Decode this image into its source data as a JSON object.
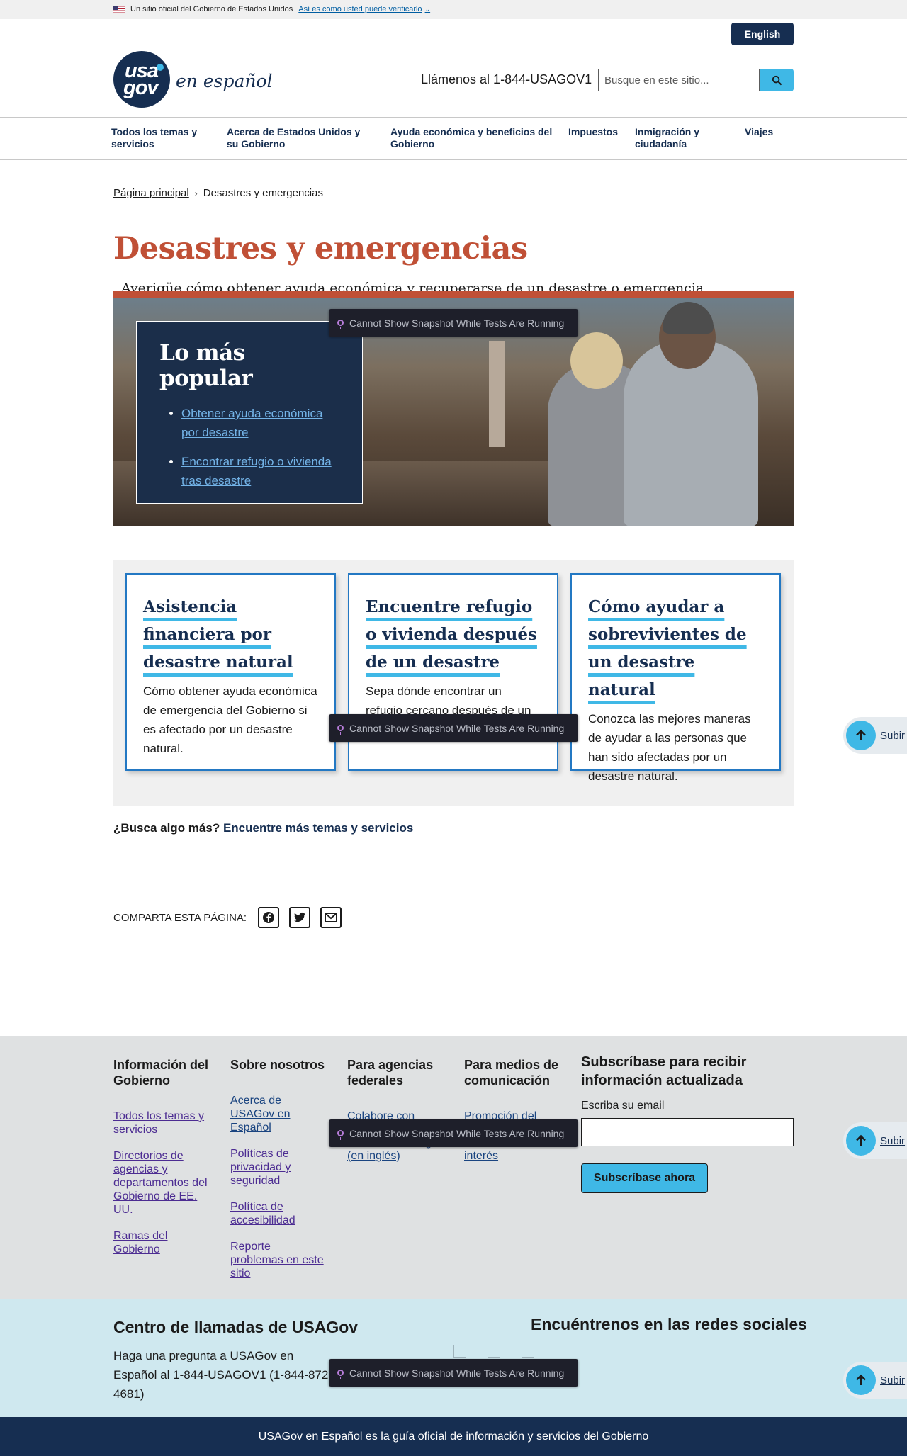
{
  "banner": {
    "official_text": "Un sitio oficial del Gobierno de Estados Unidos",
    "verify_link": "Así es como usted puede verificarlo"
  },
  "header": {
    "language_button": "English",
    "logo_usa": "usa",
    "logo_gov": "gov",
    "logo_text": "en español",
    "phone": "Llámenos al 1-844-USAGOV1",
    "search_placeholder": "Busque en este sitio..."
  },
  "nav": {
    "items": [
      {
        "label": "Todos los temas y servicios"
      },
      {
        "label": "Acerca de Estados Unidos y su Gobierno"
      },
      {
        "label": "Ayuda económica y beneficios del Gobierno"
      },
      {
        "label": "Impuestos"
      },
      {
        "label": "Inmigración y ciudadanía"
      },
      {
        "label": "Viajes"
      }
    ]
  },
  "breadcrumb": {
    "home": "Página principal",
    "current": "Desastres y emergencias"
  },
  "page": {
    "title": "Desastres y emergencias",
    "intro": "Averigüe cómo obtener ayuda económica y recuperarse de un desastre o emergencia."
  },
  "popular": {
    "title": "Lo más popular",
    "links": [
      "Obtener ayuda económica por desastre",
      "Encontrar refugio o vivienda tras desastre"
    ]
  },
  "cards": [
    {
      "title": "Asistencia financiera por desastre natural",
      "description": "Cómo obtener ayuda económica de emergencia del Gobierno si es afectado por un desastre natural."
    },
    {
      "title": "Encuentre refugio o vivienda después de un desastre",
      "description": "Sepa dónde encontrar un refugio cercano después de un desastre y tras emergencias."
    },
    {
      "title": "Cómo ayudar a sobrevivientes de un desastre natural",
      "description": "Conozca las mejores maneras de ayudar a las personas que han sido afectadas por un desastre natural."
    }
  ],
  "more": {
    "question": "¿Busca algo más?",
    "link": "Encuentre más temas y servicios"
  },
  "share": {
    "label": "COMPARTA ESTA PÁGINA:",
    "icons": [
      "facebook-icon",
      "twitter-icon",
      "email-icon"
    ]
  },
  "footer": {
    "columns": [
      {
        "heading": "Información del Gobierno",
        "links": [
          "Todos los temas y servicios",
          "Directorios de agencias y departamentos del Gobierno de EE. UU.",
          "Ramas del Gobierno"
        ]
      },
      {
        "heading": "Sobre nosotros",
        "links": [
          "Acerca de USAGov en Español",
          "Políticas de privacidad y seguridad",
          "Política de accesibilidad",
          "Reporte problemas en este sitio"
        ]
      },
      {
        "heading": "Para agencias federales",
        "links": [
          "Colabore con",
          "Lea nuestro blog (en inglés)"
        ]
      },
      {
        "heading": "Para medios de comunicación",
        "links": [
          "Promoción del",
          "Artículos de interés"
        ]
      }
    ],
    "subscribe": {
      "heading": "Subscríbase para recibir información actualizada",
      "email_label": "Escriba su email",
      "button": "Subscríbase ahora"
    }
  },
  "callcenter": {
    "title": "Centro de llamadas de USAGov",
    "text": "Haga una pregunta a USAGov en Español al 1-844-USAGOV1 (1-844-872-4681)",
    "social_title": "Encuéntrenos en las redes sociales"
  },
  "bottom": {
    "text": "USAGov en Español es la guía oficial de información y servicios del Gobierno"
  },
  "overlays": {
    "toast_text": "Cannot Show Snapshot While Tests Are Running",
    "back_to_top": "Subir"
  },
  "colors": {
    "navy": "#162e51",
    "accent_red": "#c05036",
    "accent_cyan": "#3fb8e6",
    "link_blue": "#005ea2"
  }
}
